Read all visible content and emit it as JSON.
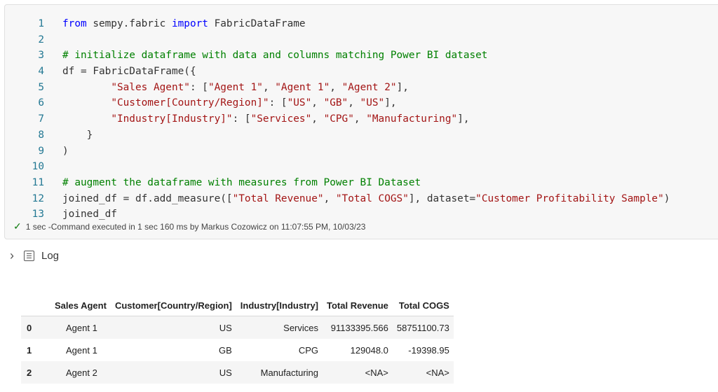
{
  "code": {
    "line_numbers": [
      "1",
      "2",
      "3",
      "4",
      "5",
      "6",
      "7",
      "8",
      "9",
      "10",
      "11",
      "12",
      "13"
    ],
    "l1": {
      "kw1": "from",
      "mod": " sempy.fabric ",
      "kw2": "import",
      "name": " FabricDataFrame"
    },
    "l3": {
      "comment": "# initialize dataframe with data and columns matching Power BI dataset"
    },
    "l4": {
      "text": "df = FabricDataFrame({"
    },
    "l5": {
      "k": "\"Sales Agent\"",
      "mid": ": [",
      "a": "\"Agent 1\"",
      "b": "\"Agent 1\"",
      "c": "\"Agent 2\"",
      "end": "],"
    },
    "l6": {
      "k": "\"Customer[Country/Region]\"",
      "mid": ": [",
      "a": "\"US\"",
      "b": "\"GB\"",
      "c": "\"US\"",
      "end": "],"
    },
    "l7": {
      "k": "\"Industry[Industry]\"",
      "mid": ": [",
      "a": "\"Services\"",
      "b": "\"CPG\"",
      "c": "\"Manufacturing\"",
      "end": "],"
    },
    "l8": {
      "text": "    }"
    },
    "l9": {
      "text": ")"
    },
    "l11": {
      "comment": "# augment the dataframe with measures from Power BI Dataset"
    },
    "l12": {
      "pre": "joined_df = df.add_measure([",
      "a": "\"Total Revenue\"",
      "sep": ", ",
      "b": "\"Total COGS\"",
      "mid": "], dataset=",
      "c": "\"Customer Profitability Sample\"",
      "end": ")"
    },
    "l13": {
      "text": "joined_df"
    },
    "comma": ", "
  },
  "status": {
    "text": "1 sec -Command executed in 1 sec 160 ms by Markus Cozowicz on 11:07:55 PM, 10/03/23"
  },
  "log": {
    "label": "Log"
  },
  "table": {
    "headers": [
      "",
      "Sales Agent",
      "Customer[Country/Region]",
      "Industry[Industry]",
      "Total Revenue",
      "Total COGS"
    ],
    "rows": [
      [
        "0",
        "Agent 1",
        "US",
        "Services",
        "91133395.566",
        "58751100.73"
      ],
      [
        "1",
        "Agent 1",
        "GB",
        "CPG",
        "129048.0",
        "-19398.95"
      ],
      [
        "2",
        "Agent 2",
        "US",
        "Manufacturing",
        "<NA>",
        "<NA>"
      ]
    ]
  },
  "colors": {
    "keyword": "#0000ff",
    "comment": "#008000",
    "string": "#a31515",
    "line_number": "#237893",
    "success": "#107c10"
  }
}
